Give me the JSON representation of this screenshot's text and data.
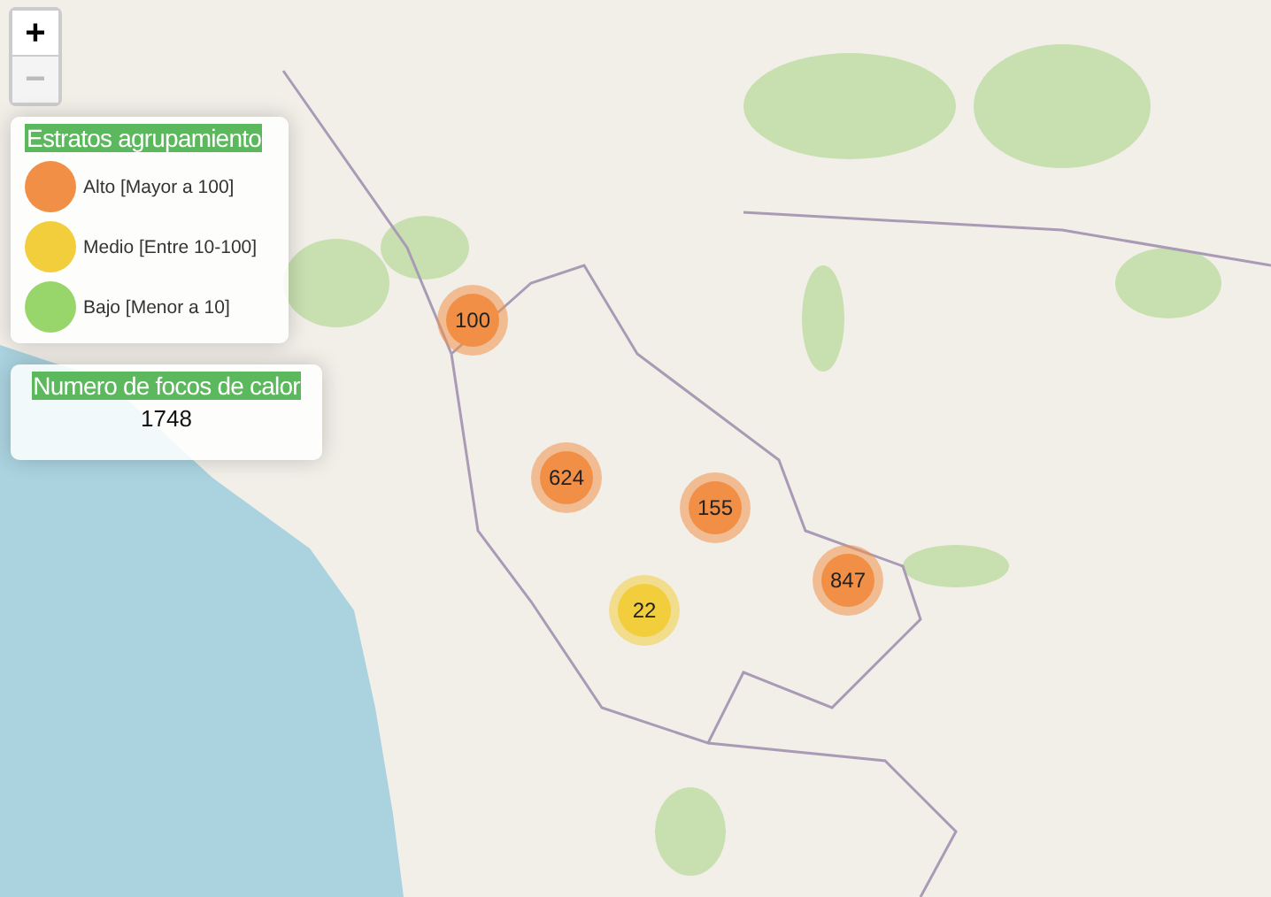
{
  "zoom_controls": [
    {
      "label": "+",
      "disabled": false
    },
    {
      "label": "−",
      "disabled": true
    }
  ],
  "legend": {
    "title": "Estratos agrupamiento",
    "items": [
      {
        "label": "Alto [Mayor a 100]",
        "color": "#f28f46"
      },
      {
        "label": "Medio [Entre 10-100]",
        "color": "#f2cd3c"
      },
      {
        "label": "Bajo [Menor a 10]",
        "color": "#98d66b"
      }
    ]
  },
  "hotspot_count": {
    "title": "Numero de focos de calor",
    "value": "1748"
  },
  "clusters": [
    {
      "count": "100",
      "color": "#f28f46"
    },
    {
      "count": "624",
      "color": "#f28f46"
    },
    {
      "count": "155",
      "color": "#f28f46"
    },
    {
      "count": "847",
      "color": "#f28f46"
    },
    {
      "count": "22",
      "color": "#f2cd3c"
    }
  ]
}
